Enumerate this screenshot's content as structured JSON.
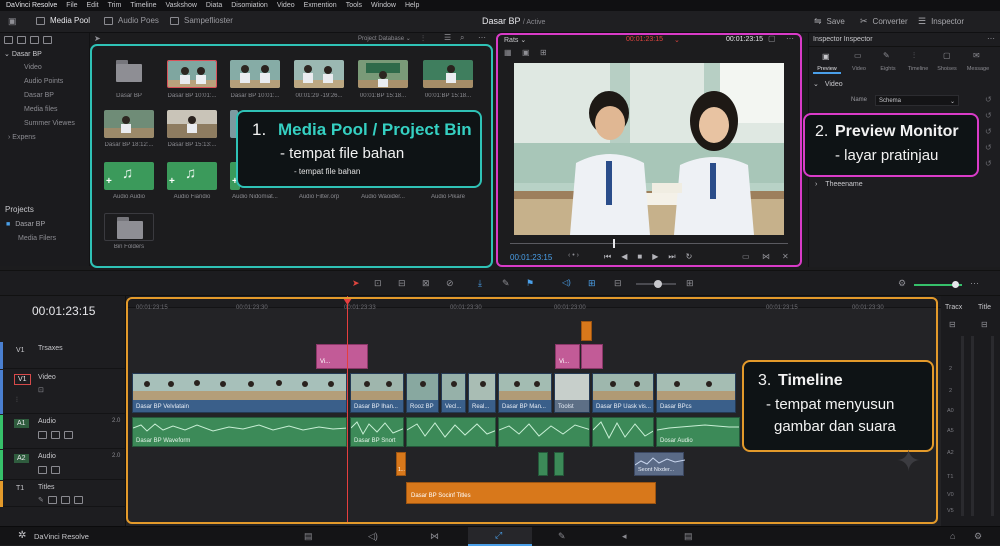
{
  "menubar": {
    "items": [
      "DaVinci Resolve",
      "File",
      "Edit",
      "Trim",
      "Timeline",
      "Vaskshow",
      "Diata",
      "Disomiation",
      "Video",
      "Exmention",
      "Tools",
      "Window",
      "Help"
    ]
  },
  "toolbar": {
    "tab_media_pool": "Media Pool",
    "tab_audio": "Audio Poes",
    "tab_sample": "Sampeflioster",
    "project_name": "Dasar BP",
    "project_status": "/ Active",
    "save_label": "Save",
    "converter_label": "Converter",
    "inspector_label": "Inspector"
  },
  "sidebar": {
    "root_label": "Dasar BP",
    "items": [
      "Video",
      "Audio Points",
      "Dasar BP",
      "Media files",
      "Summer Viewes",
      "Expens"
    ],
    "projects_heading": "Projects",
    "project_items": [
      "Dasar BP",
      "Media Filers"
    ]
  },
  "media_pool": {
    "database_label": "Project Database",
    "clips_row1": [
      "Dasar BP",
      "Dasar BP 10:01:...",
      "Dasar BP 10:01:...",
      "00:01:29 -19:26...",
      "00:01:BP 15:18...",
      "00:01:BP 15:18..."
    ],
    "clips_row2": [
      "Dasar BP 18:12:...",
      "Dasar BP 15:13:..."
    ],
    "clips_row3": [
      "Audio Audio",
      "Audio Fiaridio",
      "Audio Nidomiat...",
      "Audio Filter.orp",
      "Audio Waoider...",
      "Audio Pikare"
    ],
    "bin_folder_label": "Bin Folders",
    "annotation": {
      "number": "1.",
      "title": "Media Pool / Project Bin",
      "line1": "- tempat file bahan",
      "line2": "- tempat file bahan"
    }
  },
  "viewer": {
    "dropdown_label": "Rats",
    "timecode_red": "00:01:23:15",
    "timecode_white": "00:01:23:15",
    "current_timecode": "00:01:23:15",
    "annotation": {
      "number": "2.",
      "title": "Preview Monitor",
      "line1": "- layar pratinjau"
    }
  },
  "inspector": {
    "title": "Inspector Inspector",
    "tabs": [
      "Preview",
      "Video",
      "Eights",
      "Timeline",
      "Shoises",
      "Message"
    ],
    "section_video": "Video",
    "name_field_label": "Name",
    "name_field_value": "Schema",
    "section_theme": "Theeename"
  },
  "timeline": {
    "timecode": "00:01:23:15",
    "ruler_ticks": [
      "00:01:23:15",
      "00:01:23:30",
      "00:01:23:33",
      "00:01:23:30",
      "00:01:23:00",
      "00:01:23:15",
      "00:01:23:30"
    ],
    "tracks": [
      {
        "id": "V1",
        "name": "Trsaxes"
      },
      {
        "id": "V1",
        "name": "Video"
      },
      {
        "id": "A1",
        "name": "Audio",
        "level": "2.0"
      },
      {
        "id": "A2",
        "name": "Audio",
        "level": "2.0"
      },
      {
        "id": "T1",
        "name": "Titles"
      }
    ],
    "video_clips": [
      "Dasar BP Velvlatain",
      "Dasar BP Ihan...",
      "Rooz BP",
      "Vecl...",
      "Real...",
      "Dasar BP Man...",
      "Toolst",
      "Dasar BP Uask vis...",
      "Dasar BPcs"
    ],
    "audio_clips": [
      "Dasar BP Waveform",
      "Dasar BP Snort",
      "Dosar Audio"
    ],
    "audio2_clips": [
      "1...",
      "Seont Nixder..."
    ],
    "title_clip": "Dasar BP Socinf Titles",
    "pink_clips": [
      "Vi...",
      "Vi..."
    ],
    "annotation": {
      "number": "3.",
      "title": "Timeline",
      "line1": "- tempat menyusun",
      "line2": "gambar dan suara"
    }
  },
  "meters": {
    "col_left": "Tracx",
    "col_right": "Title",
    "scale": [
      "2",
      "2",
      "A0",
      "A5",
      "A2",
      "T1",
      "V0",
      "V5"
    ]
  },
  "bottombar": {
    "app_name": "DaVinci Resolve"
  },
  "colors": {
    "media_pool_frame": "#2fc2b6",
    "viewer_frame": "#d93bc8",
    "timeline_frame": "#e39a2b",
    "playhead": "#e53e3e",
    "accent_blue": "#4a9fe8"
  }
}
